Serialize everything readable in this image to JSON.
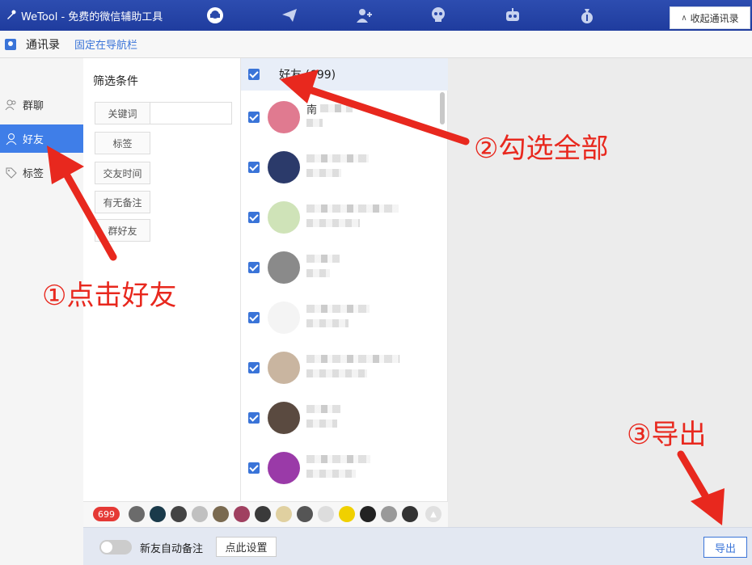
{
  "app": {
    "title": "WeTool - 免费的微信辅助工具"
  },
  "topnav": {
    "icons": [
      "headset-icon",
      "paper-plane-icon",
      "add-person-icon",
      "skull-icon",
      "robot-icon",
      "money-bag-icon"
    ]
  },
  "collapse": {
    "label": "收起通讯录"
  },
  "subbar": {
    "title": "通讯录",
    "pin_label": "固定在导航栏"
  },
  "sidebar": {
    "items": [
      {
        "label": "群聊",
        "icon": "group-icon"
      },
      {
        "label": "好友",
        "icon": "person-icon",
        "active": true
      },
      {
        "label": "标签",
        "icon": "tag-icon"
      }
    ]
  },
  "filter": {
    "title": "筛选条件",
    "buttons": [
      "关键词",
      "标签",
      "交友时间",
      "有无备注",
      "群好友"
    ]
  },
  "list": {
    "header": "好友 (699)",
    "rows": [
      {
        "name": "南",
        "avatar_color": "#e07a90"
      },
      {
        "name": "",
        "avatar_color": "#2b3a6a"
      },
      {
        "name": "",
        "avatar_color": "#cfe3b8"
      },
      {
        "name": "",
        "avatar_color": "#8a8a8a"
      },
      {
        "name": "",
        "avatar_color": "#f4f4f4"
      },
      {
        "name": "",
        "avatar_color": "#c9b5a0"
      },
      {
        "name": "",
        "avatar_color": "#5a4a40"
      },
      {
        "name": "",
        "avatar_color": "#9a3aa8"
      }
    ]
  },
  "strip": {
    "count": "699",
    "colors": [
      "#6b6b6b",
      "#1a3a4a",
      "#444",
      "#c0c0c0",
      "#7a6a50",
      "#a04060",
      "#3a3a3a",
      "#e0d0a0",
      "#555",
      "#ddd",
      "#f0d000",
      "#222",
      "#999",
      "#333"
    ]
  },
  "bottom": {
    "auto_note": "新友自动备注",
    "settings_label": "点此设置",
    "export_label": "导出"
  },
  "annotations": {
    "step1": "①点击好友",
    "step2": "②勾选全部",
    "step3": "③导出"
  },
  "colors": {
    "accent": "#3a74d8",
    "annotation": "#e8281e",
    "titlebar": "#2a49aa"
  }
}
